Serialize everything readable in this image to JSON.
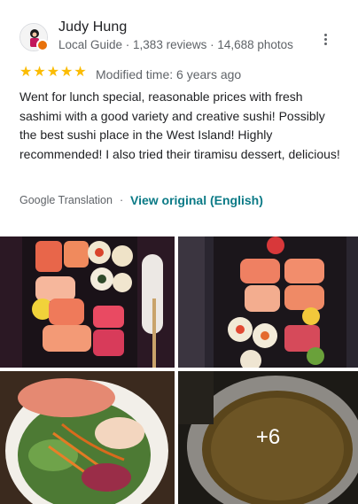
{
  "reviewer": {
    "name": "Judy Hung",
    "meta": "Local Guide · 1,383 reviews · 14,688 photos"
  },
  "rating": {
    "stars": 5,
    "modified": "Modified time: 6 years ago"
  },
  "review": {
    "text": "Went for lunch special, reasonable prices with fresh sashimi with a good variety and creative sushi! Possibly the best sushi place in the West Island! Highly recommended! I also tried their tiramisu dessert, delicious!"
  },
  "translation": {
    "label": "Google Translation",
    "separator": "·",
    "view_original": "View original (English)"
  },
  "photos": {
    "more_count": "+6"
  },
  "colors": {
    "star": "#fbbc04",
    "link": "#0b7a86",
    "muted": "#5f6368"
  }
}
